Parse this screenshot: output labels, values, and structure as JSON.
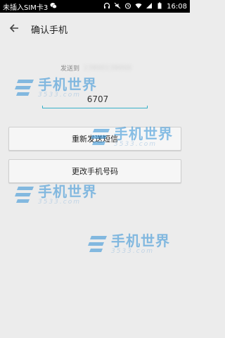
{
  "status_bar": {
    "carrier": "未插入SIM卡3",
    "time": "16:08"
  },
  "app_bar": {
    "title": "确认手机"
  },
  "sent_to": {
    "label": "发送到",
    "phone": "13800138000"
  },
  "code_input": {
    "value": "6707"
  },
  "buttons": {
    "resend": "重新发送短信",
    "change": "更改手机号码"
  },
  "watermark": {
    "cn": "手机世界",
    "num": "3533.com"
  },
  "colors": {
    "accent": "#38b0c8",
    "background": "#ececec",
    "watermark": "#2c8fd6"
  }
}
